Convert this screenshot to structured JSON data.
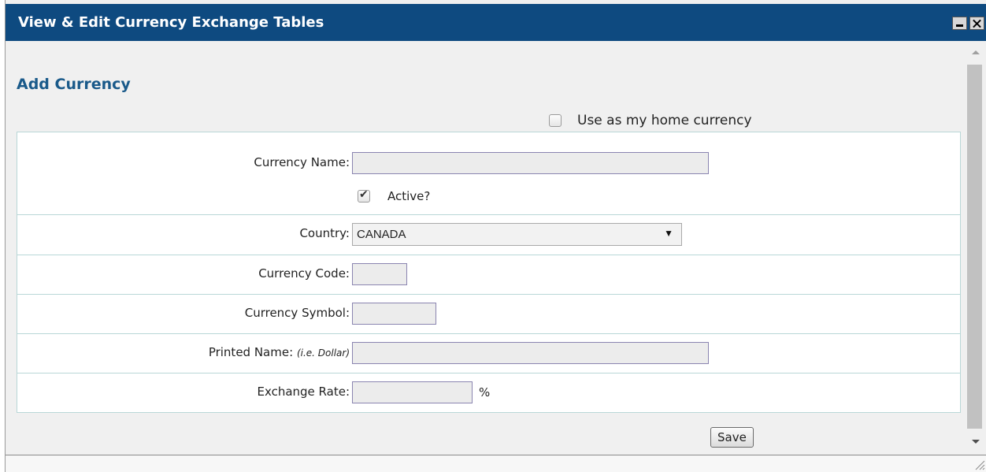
{
  "window": {
    "title": "View & Edit Currency Exchange Tables"
  },
  "form": {
    "section_title": "Add Currency",
    "home_currency_label": "Use as my home currency",
    "home_currency_checked": false,
    "currency_name_label": "Currency Name:",
    "currency_name_value": "",
    "active_label": "Active?",
    "active_checked": true,
    "country_label": "Country:",
    "country_value": "CANADA",
    "currency_code_label": "Currency Code:",
    "currency_code_value": "",
    "currency_symbol_label": "Currency Symbol:",
    "currency_symbol_value": "",
    "printed_name_label": "Printed Name:",
    "printed_name_hint": "(i.e. Dollar)",
    "printed_name_value": "",
    "exchange_rate_label": "Exchange Rate:",
    "exchange_rate_value": "",
    "exchange_rate_unit": "%",
    "save_label": "Save"
  },
  "colors": {
    "titlebar": "#0e4a80",
    "section_title": "#1a5a8a",
    "table_border": "#b9d7d7",
    "input_border": "#8a84b0"
  }
}
